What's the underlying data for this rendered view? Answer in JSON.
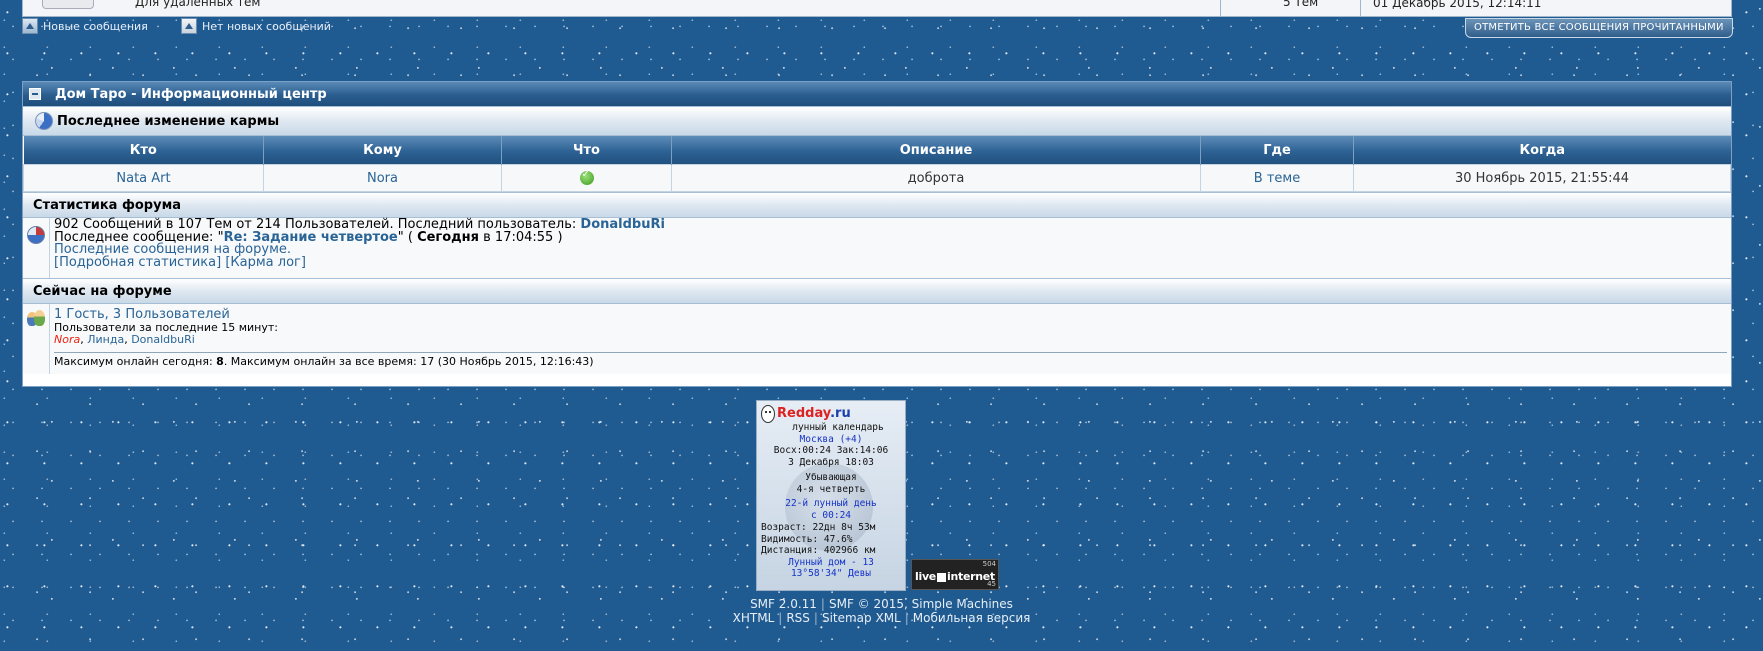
{
  "top_remnant": {
    "board_text": "Для удаленных тем",
    "topics_count": "5 Тем",
    "last_post_date": "01 Декабрь 2015, 12:14:11"
  },
  "legend": {
    "new_posts": "Новые сообщения",
    "no_new_posts": "Нет новых сообщений",
    "mark_all_read": "ОТМЕТИТЬ ВСЕ СООБЩЕНИЯ ПРОЧИТАННЫМИ"
  },
  "info_center": {
    "title": "Дом Таро - Информационный центр",
    "karma": {
      "heading": "Последнее изменение кармы",
      "columns": [
        "Кто",
        "Кому",
        "Что",
        "Описание",
        "Где",
        "Когда"
      ],
      "rows": [
        {
          "who": "Nata Art",
          "whom": "Nora",
          "what_icon": "karma-plus-icon",
          "description": "доброта",
          "where": "В теме",
          "when": "30 Ноябрь 2015, 21:55:44"
        }
      ]
    },
    "stats": {
      "heading": "Статистика форума",
      "summary": "902 Сообщений в 107 Тем от 214 Пользователей. Последний пользователь: ",
      "latest_member": "DonaldbuRi",
      "last_post_label": "Последнее сообщение: ",
      "last_post_title": "Re: Задание четвертое",
      "last_post_day": "Сегодня",
      "last_post_time": " в 17:04:55 )",
      "recent_posts_link": "Последние сообщения на форуме.",
      "detailed_stats_link": "[Подробная статистика]",
      "karma_log_link": "[Карма лог]"
    },
    "online": {
      "heading": "Сейчас на форуме",
      "guests_users": "1 Гость, 3 Пользователей",
      "last_15": "Пользователи за последние 15 минут:",
      "users": [
        "Nora",
        "Линда",
        "DonaldbuRi"
      ],
      "max_today_label": "Максимум онлайн сегодня: ",
      "max_today": "8",
      "max_all_label": ". Максимум онлайн за все время: 17 (30 Ноябрь 2015, 12:16:43)"
    }
  },
  "moon_widget": {
    "brand": "Redday",
    "brand_tld": ".ru",
    "subtitle": "лунный календарь",
    "city": "Москва (+4)",
    "rise_set": "Восх:00:24 Зак:14:06",
    "date": "3 Декабря 18:03",
    "phase": "Убывающая",
    "quarter": "4-я четверть",
    "lunar_day": "22-й лунный день",
    "lunar_day_since": "с 00:24",
    "age": "Возраст: 22дн 8ч 53м",
    "visibility": "Видимость: 47.6%",
    "distance": "Дистанция: 402966 км",
    "lunar_house": "Лунный дом - 13",
    "position": "13°58'34\" Девы"
  },
  "liveinternet": {
    "top_number": "504",
    "brand_left": "live",
    "brand_right": "internet",
    "bottom_number": "45"
  },
  "footer": {
    "smf_version": "SMF 2.0.11",
    "smf_copyright": "SMF © 2015, Simple Machines",
    "links": [
      "XHTML",
      "RSS",
      "Sitemap XML",
      "Мобильная версия"
    ]
  },
  "colors": {
    "page_bg": "#1f5a91",
    "header_blue": "#2a5d8f",
    "link": "#2a6496",
    "online_user_red": "#ee2211"
  }
}
